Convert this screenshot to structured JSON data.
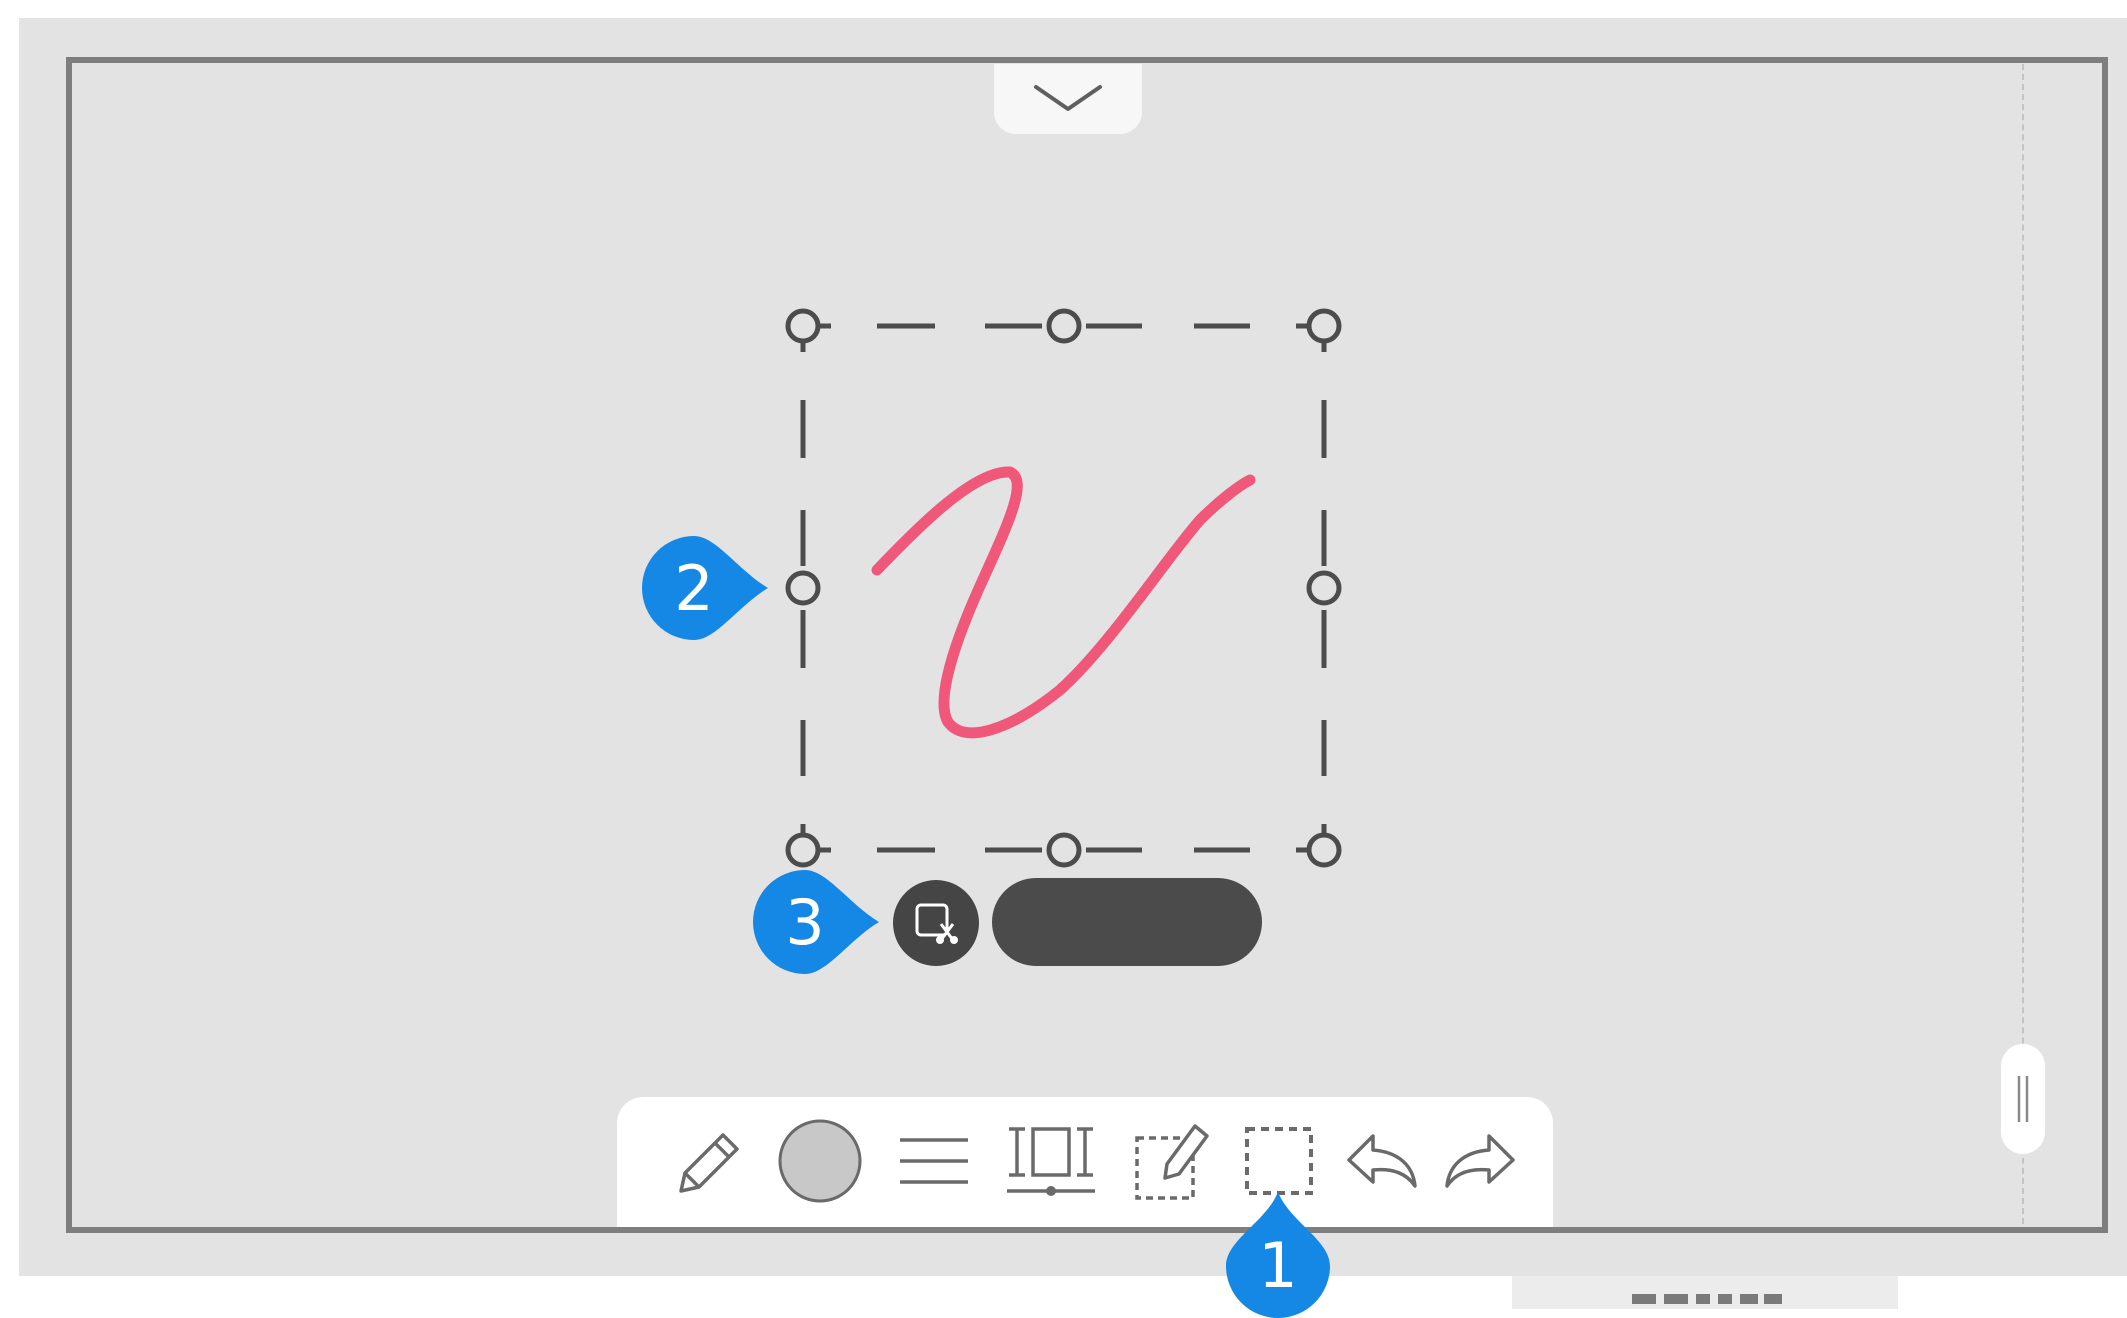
{
  "app": {
    "colors": {
      "background": "#e3e3e3",
      "frame": "#7e7e7e",
      "stroke_ink": "#f0587a",
      "callout": "#1588e6",
      "selection": "#4b4b4b"
    }
  },
  "top_tab": {
    "icon": "chevron-down-icon"
  },
  "selection_menu": {
    "icon": "crop-icon",
    "pill_label": ""
  },
  "toolbar": {
    "tools": [
      {
        "name": "pen",
        "icon": "pencil-icon"
      },
      {
        "name": "color",
        "icon": "color-swatch-icon"
      },
      {
        "name": "stroke-width",
        "icon": "lines-icon"
      },
      {
        "name": "page-size",
        "icon": "fit-width-icon"
      },
      {
        "name": "edit",
        "icon": "edit-note-icon"
      },
      {
        "name": "select",
        "icon": "selection-icon"
      },
      {
        "name": "undo",
        "icon": "undo-icon"
      },
      {
        "name": "redo",
        "icon": "redo-icon"
      }
    ]
  },
  "callouts": [
    "1",
    "2",
    "3"
  ]
}
